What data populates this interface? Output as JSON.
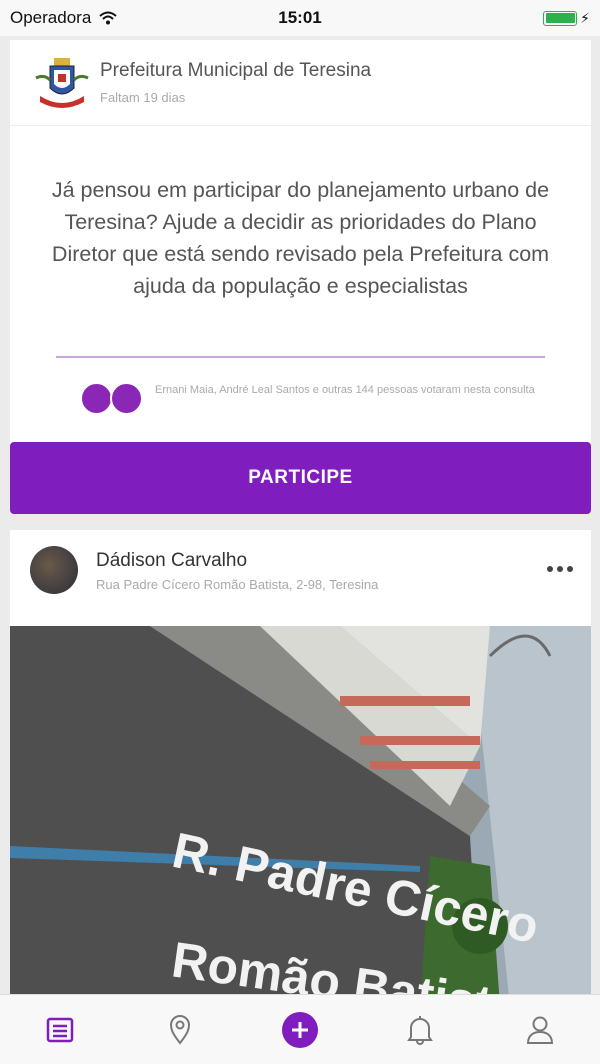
{
  "status_bar": {
    "carrier": "Operadora",
    "time": "15:01"
  },
  "consultation": {
    "organization": "Prefeitura Municipal de Teresina",
    "deadline": "Faltam 19 dias",
    "question": "Já pensou em participar do planejamento urbano de Teresina? Ajude a decidir as prioridades do Plano Diretor que está sendo revisado pela Prefeitura com ajuda da população e especialistas",
    "voters_text": "Ernani Maia, André Leal Santos e outras 144 pessoas votaram nesta consulta",
    "cta_label": "PARTICIPE"
  },
  "post": {
    "author": "Dádison Carvalho",
    "address": "Rua Padre Cícero Romão Batista, 2-98, Teresina",
    "photo_sign_line1": "R. Padre Cícero",
    "photo_sign_line2": "Romão Batista"
  },
  "bottom_nav": [
    "feed-icon",
    "location-pin-icon",
    "add-icon",
    "bell-icon",
    "user-icon"
  ],
  "colors": {
    "accent": "#7f1dbf",
    "battery": "#2cb24a"
  }
}
